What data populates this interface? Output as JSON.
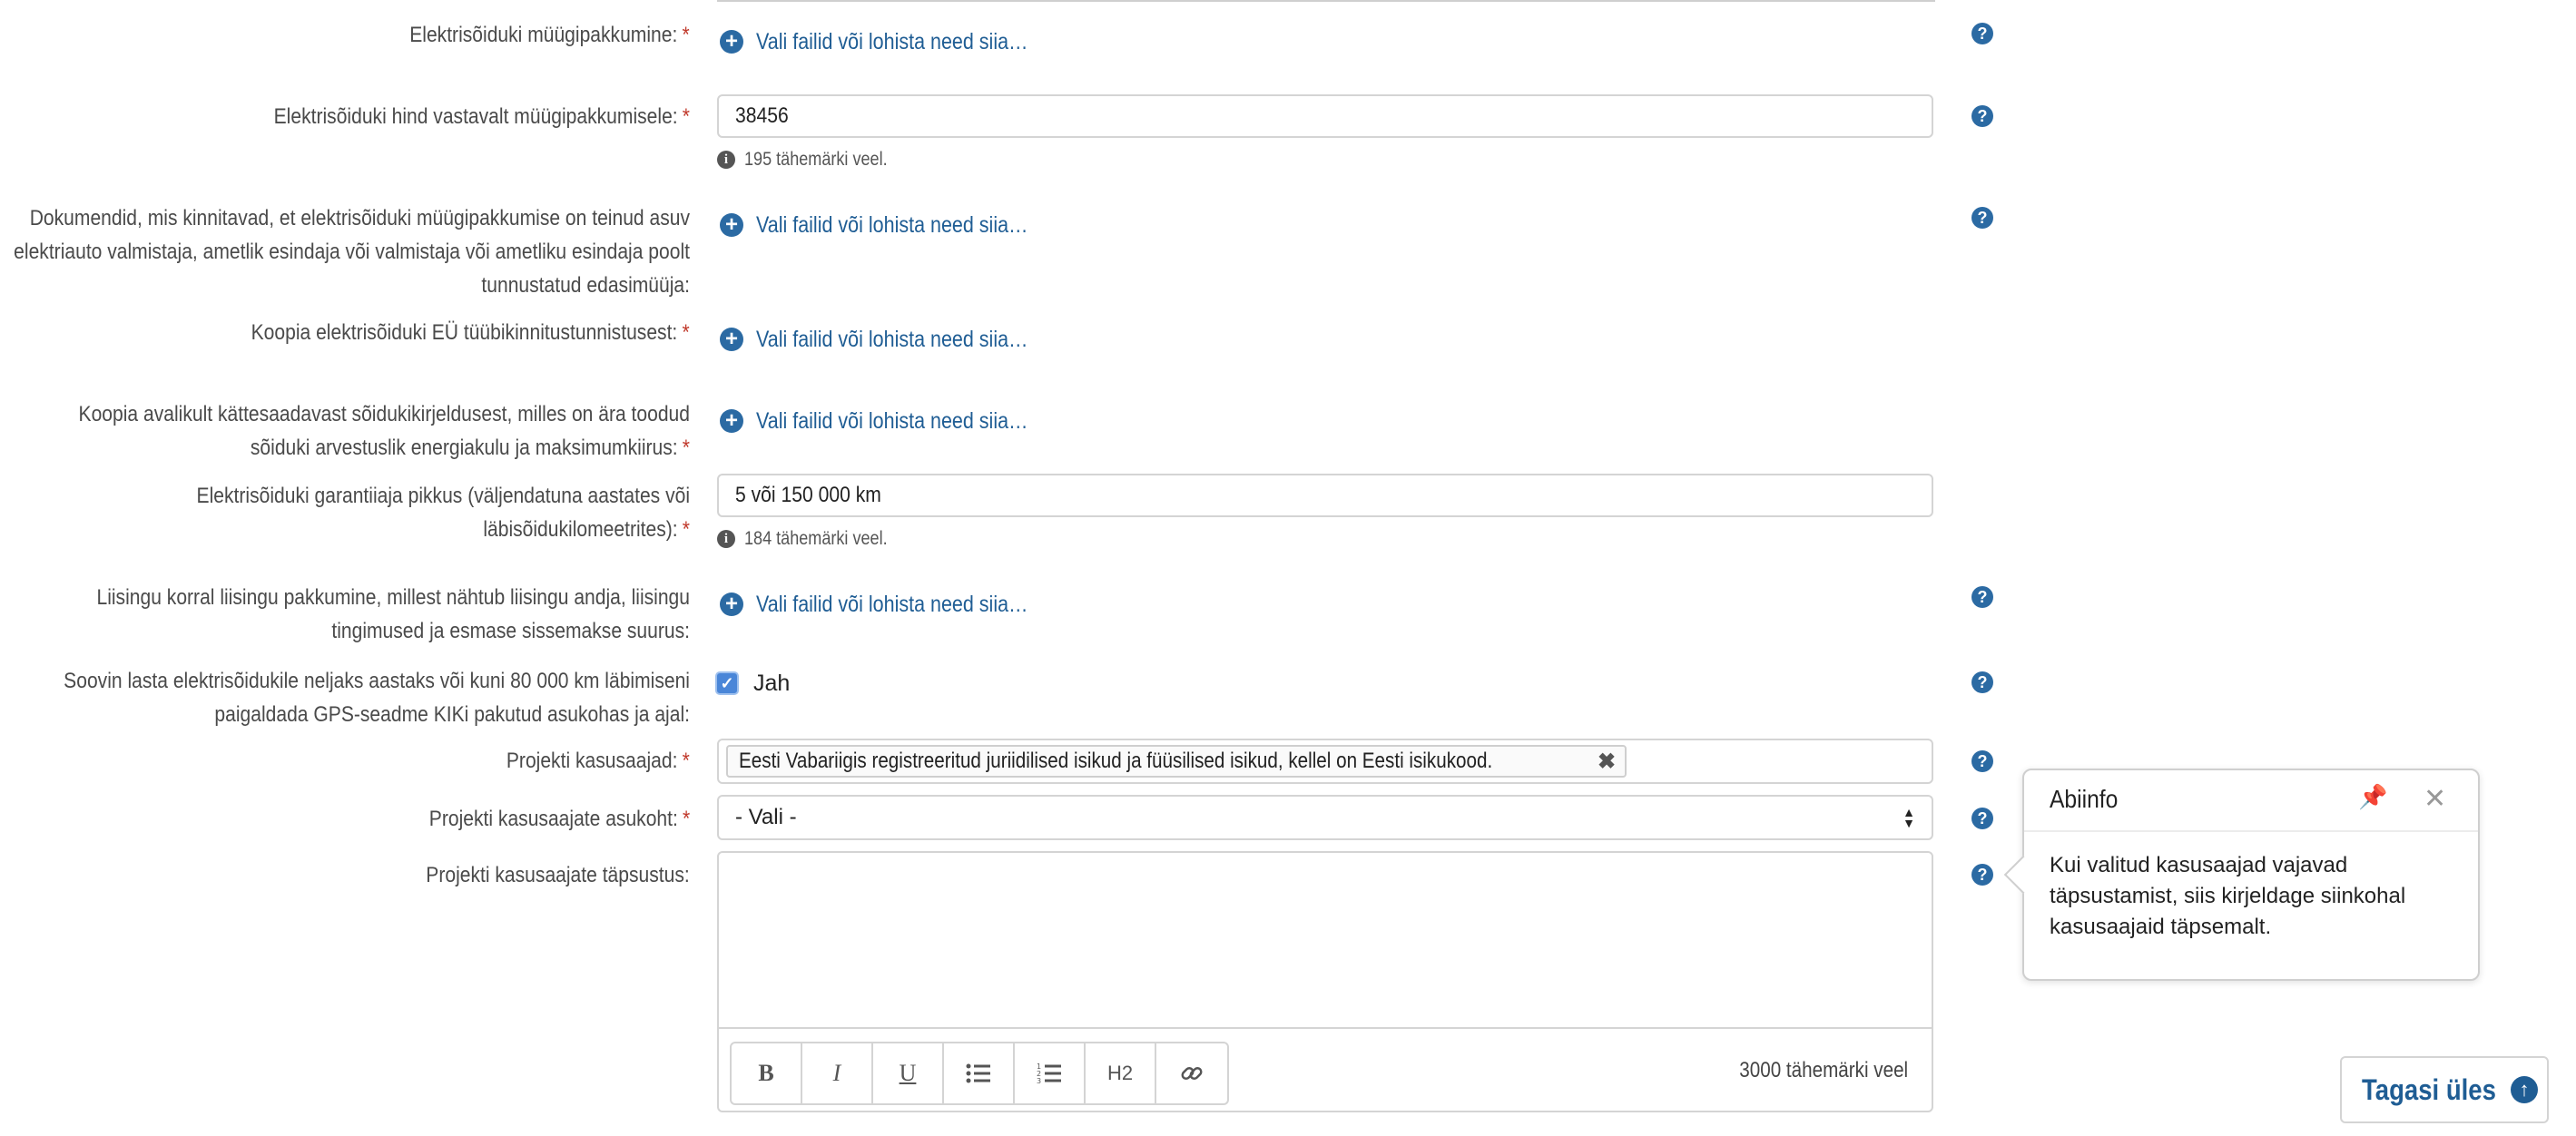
{
  "upload_text": "Vali failid või lohista need siia…",
  "fields": {
    "f1": {
      "label": "Elektrisõiduki müügipakkumine:",
      "required": "*"
    },
    "f2": {
      "label": "Elektrisõiduki hind vastavalt müügipakkumisele:",
      "required": "*",
      "value": "38456",
      "counter": "195 tähemärki veel."
    },
    "f3": {
      "label": "Dokumendid, mis kinnitavad, et elektrisõiduki müügipakkumise on teinud asuv elektriauto valmistaja, ametlik esindaja või valmistaja või ametliku esindaja poolt tunnustatud edasimüüja:"
    },
    "f4": {
      "label": "Koopia elektrisõiduki EÜ tüübikinnitustunnistusest:",
      "required": "*"
    },
    "f5": {
      "label": "Koopia avalikult kättesaadavast sõidukikirjeldusest, milles on ära toodud sõiduki arvestuslik energiakulu ja maksimumkiirus:",
      "required": "*"
    },
    "f6": {
      "label": "Elektrisõiduki garantiiaja pikkus (väljendatuna aastates või läbisõidukilomeetrites):",
      "required": "*",
      "value": "5 või 150 000 km",
      "counter": "184 tähemärki veel."
    },
    "f7": {
      "label": "Liisingu korral liisingu pakkumine, millest nähtub liisingu andja, liisingu tingimused ja esmase sissemakse suurus:"
    },
    "f8": {
      "label": "Soovin lasta elektrisõidukile neljaks aastaks või kuni 80 000 km läbimiseni paigaldada GPS-seadme KIKi pakutud asukohas ja ajal:",
      "check_label": "Jah",
      "checked": true
    },
    "f9": {
      "label": "Projekti kasusaajad:",
      "required": "*",
      "tag": "Eesti Vabariigis registreeritud juriidilised isikud ja füüsilised isikud, kellel on Eesti isikukood."
    },
    "f10": {
      "label": "Projekti kasusaajate asukoht:",
      "required": "*",
      "selected": "- Vali -"
    },
    "f11": {
      "label": "Projekti kasusaajate täpsustus:",
      "remaining": "3000 tähemärki veel"
    }
  },
  "toolbar": {
    "bold": "B",
    "italic": "I",
    "underline": "U",
    "h2": "H2"
  },
  "popover": {
    "title": "Abiinfo",
    "body": "Kui valitud kasusaajad vajavad täpsustamist, siis kirjeldage siinkohal kasusaajaid täpsemalt."
  },
  "back_to_top": "Tagasi üles",
  "colors": {
    "link": "#1f5d94",
    "required": "#c0392b",
    "checkbox": "#4a86d8"
  }
}
